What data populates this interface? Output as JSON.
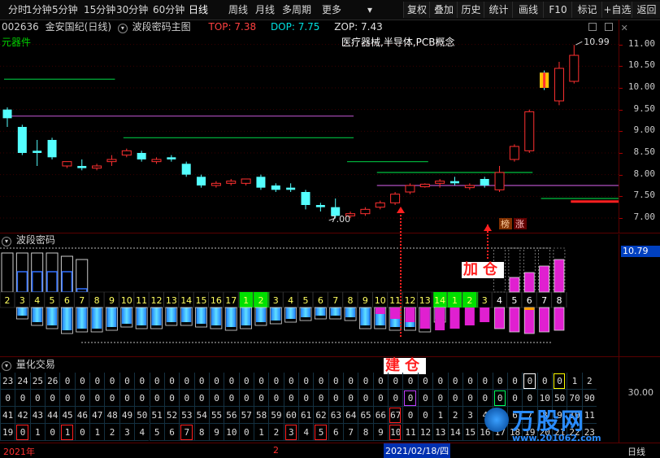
{
  "toolbar": {
    "timeframes": [
      "分时",
      "1分钟",
      "5分钟",
      "15分钟",
      "30分钟",
      "60分钟",
      "日线",
      "周线",
      "月线",
      "多周期",
      "更多"
    ],
    "active_timeframe": "日线",
    "buttons": [
      "复权",
      "叠加",
      "历史",
      "统计",
      "画线",
      "F10",
      "标记",
      "+自选",
      "返回"
    ]
  },
  "main": {
    "code": "002636",
    "name": "金安国纪(日线)",
    "indicator": "波段密码主图",
    "top_label": "TOP: 7.38",
    "dop_label": "DOP: 7.75",
    "zop_label": "ZOP: 7.43",
    "sector_tag": "元器件",
    "concept_text": "医疗器械,半导体,PCB概念",
    "high_marker": "10.99",
    "low_marker": "7.00",
    "y_ticks": [
      "11.00",
      "10.50",
      "10.00",
      "9.50",
      "9.00",
      "8.50",
      "8.00",
      "7.50",
      "7.00"
    ],
    "badge_bang": "榜",
    "badge_zhang": "涨",
    "up_color": "#ff3030",
    "down_color": "#54ffff"
  },
  "chart_data": {
    "type": "candlestick",
    "ylim": [
      6.85,
      11.2
    ],
    "candles": [
      [
        9.5,
        9.3,
        9.55,
        9.1
      ],
      [
        9.1,
        8.5,
        9.15,
        8.45
      ],
      [
        8.55,
        8.5,
        8.8,
        8.2
      ],
      [
        8.8,
        8.4,
        8.85,
        8.35
      ],
      [
        8.2,
        8.3,
        8.3,
        8.15
      ],
      [
        8.2,
        8.15,
        8.35,
        8.1
      ],
      [
        8.15,
        8.2,
        8.25,
        8.1
      ],
      [
        8.3,
        8.35,
        8.45,
        8.2
      ],
      [
        8.45,
        8.55,
        8.6,
        8.4
      ],
      [
        8.5,
        8.35,
        8.55,
        8.3
      ],
      [
        8.3,
        8.35,
        8.4,
        8.25
      ],
      [
        8.4,
        8.35,
        8.45,
        8.3
      ],
      [
        8.25,
        8.0,
        8.3,
        7.95
      ],
      [
        7.95,
        7.75,
        8.0,
        7.7
      ],
      [
        7.75,
        7.8,
        7.85,
        7.7
      ],
      [
        7.8,
        7.85,
        7.9,
        7.75
      ],
      [
        7.8,
        7.9,
        7.9,
        7.75
      ],
      [
        7.95,
        7.7,
        8.0,
        7.65
      ],
      [
        7.75,
        7.65,
        7.8,
        7.6
      ],
      [
        7.7,
        7.65,
        7.8,
        7.6
      ],
      [
        7.6,
        7.3,
        7.65,
        7.2
      ],
      [
        7.3,
        7.25,
        7.35,
        7.15
      ],
      [
        7.25,
        7.05,
        7.45,
        7.0
      ],
      [
        7.05,
        7.1,
        7.15,
        7.0
      ],
      [
        7.1,
        7.2,
        7.25,
        7.05
      ],
      [
        7.25,
        7.35,
        7.4,
        7.2
      ],
      [
        7.35,
        7.55,
        7.6,
        7.3
      ],
      [
        7.6,
        7.75,
        7.8,
        7.55
      ],
      [
        7.72,
        7.78,
        7.8,
        7.7
      ],
      [
        7.8,
        7.85,
        7.9,
        7.7
      ],
      [
        7.85,
        7.8,
        7.95,
        7.75
      ],
      [
        7.7,
        7.75,
        7.8,
        7.65
      ],
      [
        7.9,
        7.75,
        7.95,
        7.7
      ],
      [
        7.65,
        8.05,
        8.2,
        7.6
      ],
      [
        8.35,
        8.65,
        8.7,
        8.3
      ],
      [
        8.55,
        9.45,
        9.5,
        8.5
      ],
      [
        10.35,
        10.0,
        10.4,
        9.95
      ],
      [
        9.7,
        10.45,
        10.6,
        9.6
      ],
      [
        10.15,
        10.75,
        10.99,
        10.1
      ]
    ],
    "horizontal_levels": [
      {
        "from": 0,
        "to": 7,
        "value": 10.2,
        "color": "#00c040"
      },
      {
        "from": 0,
        "to": 23,
        "value": 9.35,
        "color": "#b050c0"
      },
      {
        "from": 8,
        "to": 23,
        "value": 8.85,
        "color": "#00c040"
      },
      {
        "from": 23,
        "to": 28,
        "value": 8.3,
        "color": "#00c040"
      },
      {
        "from": 25,
        "to": 35,
        "value": 8.05,
        "color": "#00c040"
      },
      {
        "from": 25,
        "to": 48,
        "value": 7.75,
        "color": "#b050c0"
      },
      {
        "from": 36,
        "to": 48,
        "value": 7.45,
        "color": "#00c040"
      },
      {
        "from": 38,
        "to": 56,
        "value": 7.38,
        "color": "#ff2020"
      }
    ]
  },
  "boduan": {
    "title": "波段密码",
    "value_label": "10.79",
    "annotation_add": "加仓",
    "annotation_build": "建仓",
    "number_strip": [
      "2",
      "3",
      "4",
      "5",
      "6",
      "7",
      "8",
      "9",
      "10",
      "11",
      "12",
      "13",
      "14",
      "15",
      "16",
      "17",
      "1",
      "2",
      "3",
      "4",
      "5",
      "6",
      "7",
      "8",
      "9",
      "10",
      "11",
      "12",
      "13",
      "14",
      "1",
      "2",
      "3",
      "4",
      "5",
      "6",
      "7",
      "8"
    ]
  },
  "lianghua": {
    "title": "量化交易",
    "axis_label": "30.00",
    "rows": [
      [
        "23",
        "24",
        "25",
        "26",
        "0",
        "0",
        "0",
        "0",
        "0",
        "0",
        "0",
        "0",
        "0",
        "0",
        "0",
        "0",
        "0",
        "0",
        "0",
        "0",
        "0",
        "0",
        "0",
        "0",
        "0",
        "0",
        "0",
        "0",
        "0",
        "0",
        "0",
        "0",
        "0",
        "0",
        "0",
        "0",
        "0",
        "0",
        "1",
        "2"
      ],
      [
        "0",
        "0",
        "0",
        "0",
        "0",
        "0",
        "0",
        "0",
        "0",
        "0",
        "0",
        "0",
        "0",
        "0",
        "0",
        "0",
        "0",
        "0",
        "0",
        "0",
        "0",
        "0",
        "0",
        "0",
        "0",
        "0",
        "0",
        "0",
        "0",
        "0",
        "0",
        "0",
        "0",
        "0",
        "0",
        "0",
        "10",
        "50",
        "70",
        "90"
      ],
      [
        "41",
        "42",
        "43",
        "44",
        "45",
        "46",
        "47",
        "48",
        "49",
        "50",
        "51",
        "52",
        "53",
        "54",
        "55",
        "56",
        "57",
        "58",
        "59",
        "60",
        "61",
        "62",
        "63",
        "64",
        "65",
        "66",
        "67",
        "0",
        "0",
        "1",
        "2",
        "3",
        "4",
        "5",
        "6",
        "7",
        "8",
        "9",
        "10",
        "11"
      ],
      [
        "19",
        "0",
        "1",
        "0",
        "1",
        "0",
        "1",
        "2",
        "3",
        "4",
        "5",
        "6",
        "7",
        "8",
        "9",
        "10",
        "0",
        "1",
        "2",
        "3",
        "4",
        "5",
        "6",
        "7",
        "8",
        "9",
        "10",
        "11",
        "12",
        "13",
        "14",
        "15",
        "16",
        "17",
        "18",
        "19",
        "20",
        "21",
        "22",
        "23"
      ]
    ]
  },
  "bottom": {
    "year_label": "2021年",
    "month_label": "2",
    "cursor_date": "2021/02/18/四",
    "period_label": "日线"
  },
  "watermark": {
    "brand": "万股网",
    "url": "www.201062.com"
  }
}
